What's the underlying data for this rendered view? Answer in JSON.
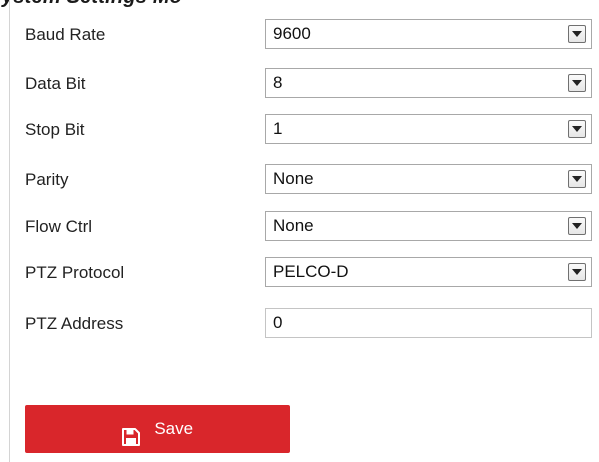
{
  "page": {
    "heading": "ystem Settings Mo"
  },
  "form": {
    "rows": [
      {
        "label": "Baud Rate",
        "value": "9600"
      },
      {
        "label": "Data Bit",
        "value": "8"
      },
      {
        "label": "Stop Bit",
        "value": "1"
      },
      {
        "label": "Parity",
        "value": "None"
      },
      {
        "label": "Flow Ctrl",
        "value": "None"
      },
      {
        "label": "PTZ Protocol",
        "value": "PELCO-D"
      }
    ],
    "address": {
      "label": "PTZ Address",
      "value": "0"
    }
  },
  "actions": {
    "save_label": "Save",
    "save_icon": "save-disk-icon"
  },
  "colors": {
    "accent": "#d9262b",
    "border": "#a8a8a8",
    "text": "#222222"
  }
}
